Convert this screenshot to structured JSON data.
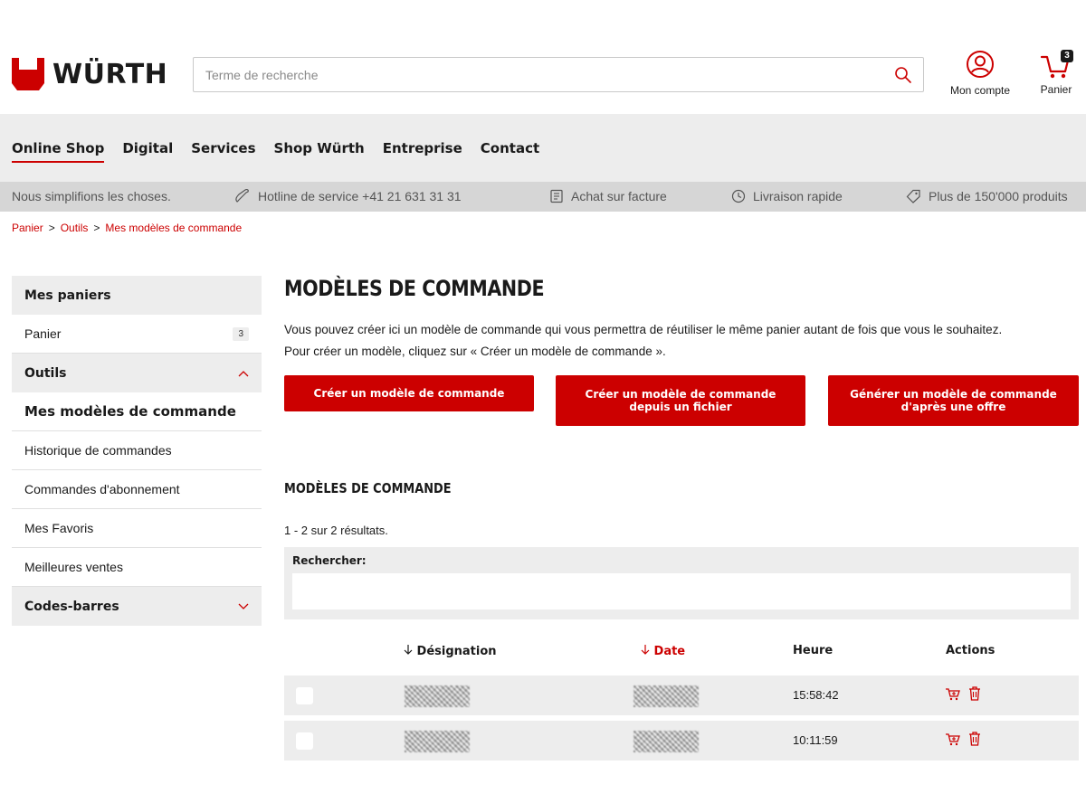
{
  "brand": {
    "name": "WÜRTH",
    "accent": "#cc0000"
  },
  "search": {
    "placeholder": "Terme de recherche"
  },
  "header": {
    "account_label": "Mon compte",
    "cart_label": "Panier",
    "cart_count": "3"
  },
  "nav": {
    "items": [
      "Online Shop",
      "Digital",
      "Services",
      "Shop Würth",
      "Entreprise",
      "Contact"
    ],
    "active": "Online Shop"
  },
  "usp": {
    "tagline": "Nous simplifions les choses.",
    "hotline": "Hotline de service +41 21 631 31 31",
    "invoice": "Achat sur facture",
    "delivery": "Livraison rapide",
    "products": "Plus de 150'000 produits"
  },
  "breadcrumb": [
    "Panier",
    "Outils",
    "Mes modèles de commande"
  ],
  "sidebar": {
    "carts_header": "Mes paniers",
    "cart_item": "Panier",
    "cart_badge": "3",
    "tools_header": "Outils",
    "tools_items": [
      "Mes modèles de commande",
      "Historique de commandes",
      "Commandes d'abonnement",
      "Mes Favoris",
      "Meilleures ventes"
    ],
    "barcodes_header": "Codes-barres"
  },
  "main": {
    "title": "MODÈLES DE COMMANDE",
    "intro_line1": "Vous pouvez créer ici un modèle de commande qui vous permettra de réutiliser le même panier autant de fois que vous le souhaitez.",
    "intro_line2": "Pour créer un modèle, cliquez sur « Créer un modèle de commande ».",
    "btn_create": "Créer un modèle de commande",
    "btn_file_1": "Créer un modèle de commande",
    "btn_file_2": "depuis un fichier",
    "btn_offer_1": "Générer un modèle de commande",
    "btn_offer_2": "d'après une offre",
    "section_title": "MODÈLES DE COMMANDE",
    "results": "1 - 2 sur 2 résultats.",
    "filter_label": "Rechercher:"
  },
  "table": {
    "headers": {
      "designation": "Désignation",
      "date": "Date",
      "time": "Heure",
      "actions": "Actions"
    },
    "rows": [
      {
        "time": "15:58:42"
      },
      {
        "time": "10:11:59"
      }
    ]
  }
}
